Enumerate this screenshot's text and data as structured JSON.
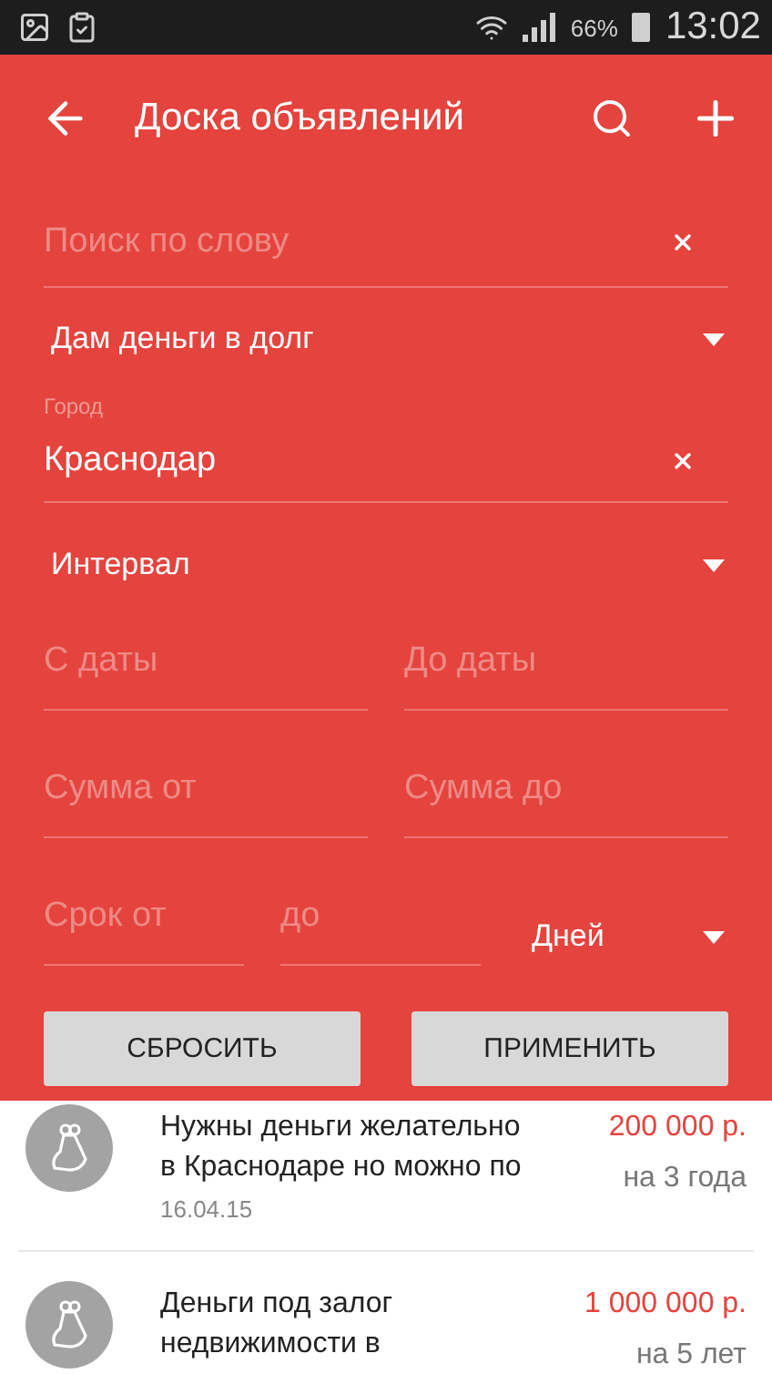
{
  "status_bar": {
    "battery": "66%",
    "time": "13:02"
  },
  "app_bar": {
    "title": "Доска объявлений"
  },
  "filters": {
    "search": {
      "placeholder": "Поиск по слову"
    },
    "type": {
      "value": "Дам деньги в долг"
    },
    "city": {
      "label": "Город",
      "value": "Краснодар"
    },
    "period": {
      "value": "Интервал"
    },
    "date_from": {
      "placeholder": "С даты"
    },
    "date_to": {
      "placeholder": "До даты"
    },
    "sum_from": {
      "placeholder": "Сумма от"
    },
    "sum_to": {
      "placeholder": "Сумма до"
    },
    "term_from": {
      "placeholder": "Срок от"
    },
    "term_to": {
      "placeholder": "до"
    },
    "term_unit": {
      "value": "Дней"
    }
  },
  "buttons": [
    {
      "label": "СБРОСИТЬ"
    },
    {
      "label": "ПРИМЕНИТЬ"
    }
  ],
  "listings": [
    {
      "title": "Нужны деньги желательно в Краснодаре но можно по",
      "date": "16.04.15",
      "amount": "200 000  р.",
      "term": "на 3 года"
    },
    {
      "title": "Деньги под залог недвижимости в",
      "amount": "1 000 000  р.",
      "term": "на 5 лет"
    }
  ]
}
